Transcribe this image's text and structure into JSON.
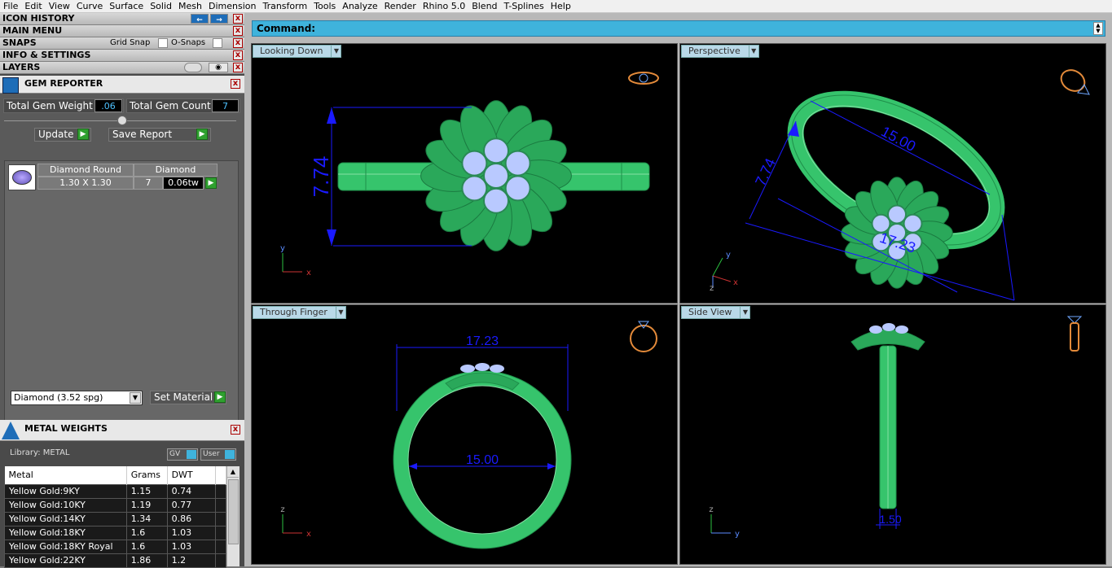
{
  "menu": [
    "File",
    "Edit",
    "View",
    "Curve",
    "Surface",
    "Solid",
    "Mesh",
    "Dimension",
    "Transform",
    "Tools",
    "Analyze",
    "Render",
    "Rhino 5.0",
    "Blend",
    "T-Splines",
    "Help"
  ],
  "panels": {
    "icon_history": "ICON HISTORY",
    "main_menu": "MAIN MENU",
    "snaps": "SNAPS",
    "grid_snap": "Grid Snap",
    "o_snaps": "O-Snaps",
    "info_settings": "INFO & SETTINGS",
    "layers": "LAYERS"
  },
  "gem_reporter": {
    "title": "GEM REPORTER",
    "total_weight_label": "Total Gem Weight",
    "total_weight_value": ".06",
    "total_count_label": "Total Gem Count",
    "total_count_value": "7",
    "update_label": "Update",
    "save_label": "Save Report",
    "gem_name": "Diamond Round",
    "gem_material": "Diamond",
    "gem_size": "1.30 X 1.30",
    "gem_qty": "7",
    "gem_weight": "0.06tw",
    "material_select": "Diamond      (3.52 spg)",
    "set_material_label": "Set Material"
  },
  "metal_weights": {
    "title": "METAL WEIGHTS",
    "library": "Library: METAL",
    "gv": "GV",
    "user": "User",
    "columns": [
      "Metal",
      "Grams",
      "DWT"
    ],
    "rows": [
      [
        "Yellow Gold:9KY",
        "1.15",
        "0.74"
      ],
      [
        "Yellow Gold:10KY",
        "1.19",
        "0.77"
      ],
      [
        "Yellow Gold:14KY",
        "1.34",
        "0.86"
      ],
      [
        "Yellow Gold:18KY",
        "1.6",
        "1.03"
      ],
      [
        "Yellow Gold:18KY Royal",
        "1.6",
        "1.03"
      ],
      [
        "Yellow Gold:22KY",
        "1.86",
        "1.2"
      ]
    ]
  },
  "command_label": "Command:",
  "viewports": {
    "top": {
      "title": "Looking Down",
      "dim": "7.74"
    },
    "persp": {
      "title": "Perspective",
      "dim_a": "15.00",
      "dim_b": "7.74",
      "dim_c": "17.23"
    },
    "front": {
      "title": "Through Finger",
      "dim_a": "17.23",
      "dim_b": "15.00"
    },
    "side": {
      "title": "Side View",
      "dim": "1.50"
    }
  },
  "colors": {
    "ring": "#2fbf6a",
    "dim": "#1a1aff",
    "accent": "#3fb3dc"
  }
}
